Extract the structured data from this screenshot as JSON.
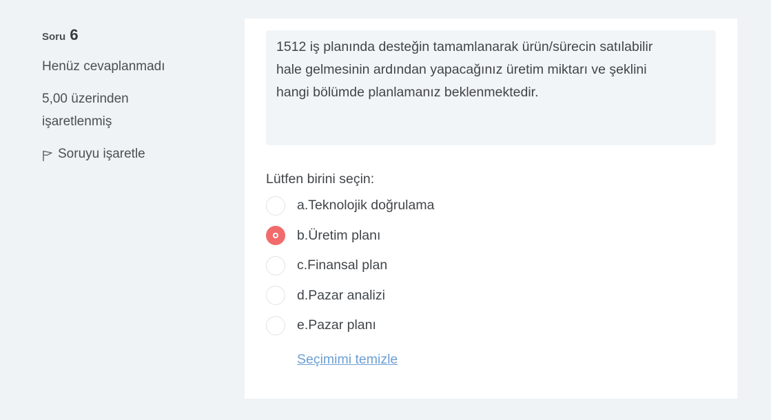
{
  "info": {
    "question_prefix": "Soru",
    "question_number": "6",
    "state": "Henüz cevaplanmadı",
    "grade_line1": "5,00 üzerinden",
    "grade_line2": "işaretlenmiş",
    "flag_label": "Soruyu işaretle",
    "flag_icon": "flag-icon"
  },
  "question": {
    "text_line1": "1512 iş planında desteğin tamamlanarak ürün/sürecin satılabilir",
    "text_line2": "hale gelmesinin ardından yapacağınız üretim miktarı ve şeklini",
    "text_line3": "hangi bölümde planlamanız beklenmektedir.",
    "prompt": "Lütfen birini seçin:",
    "options": [
      {
        "label": "a.Teknolojik doğrulama",
        "selected": false
      },
      {
        "label": "b.Üretim planı",
        "selected": true
      },
      {
        "label": "c.Finansal plan",
        "selected": false
      },
      {
        "label": "d.Pazar analizi",
        "selected": false
      },
      {
        "label": "e.Pazar planı",
        "selected": false
      }
    ],
    "clear_label": "Seçimimi temizle"
  },
  "colors": {
    "background": "#f0f3f5",
    "selected_radio": "#f26b6b",
    "link": "#6b9fd3"
  }
}
